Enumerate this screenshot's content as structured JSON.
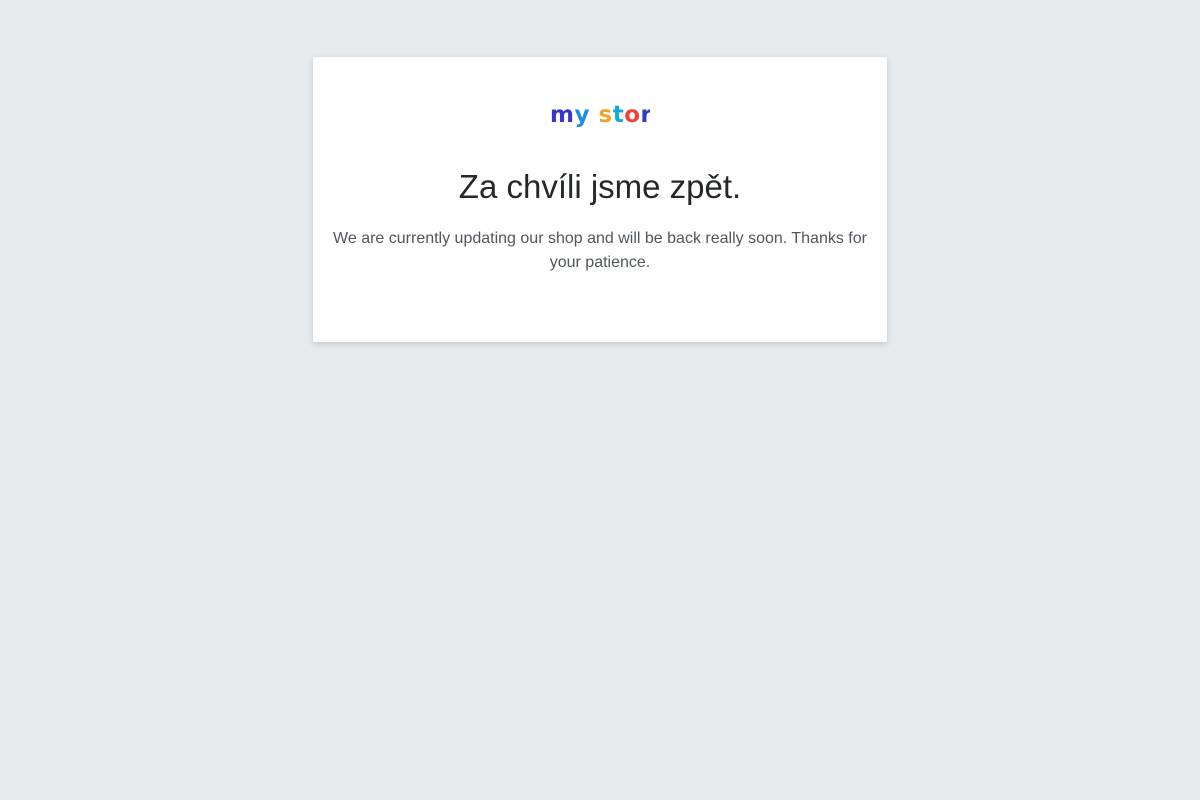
{
  "logo": {
    "text": "my store",
    "colors": {
      "m": "#3a36c8",
      "y": "#1f8fdc",
      "s": "#f0a330",
      "t": "#1aa8d8",
      "o": "#e8453c",
      "r": "#2e3fbf",
      "e": "#e0443e"
    }
  },
  "maintenance": {
    "title": "Za chvíli jsme zpět.",
    "message": "We are currently updating our shop and will be back really soon. Thanks for your patience."
  }
}
